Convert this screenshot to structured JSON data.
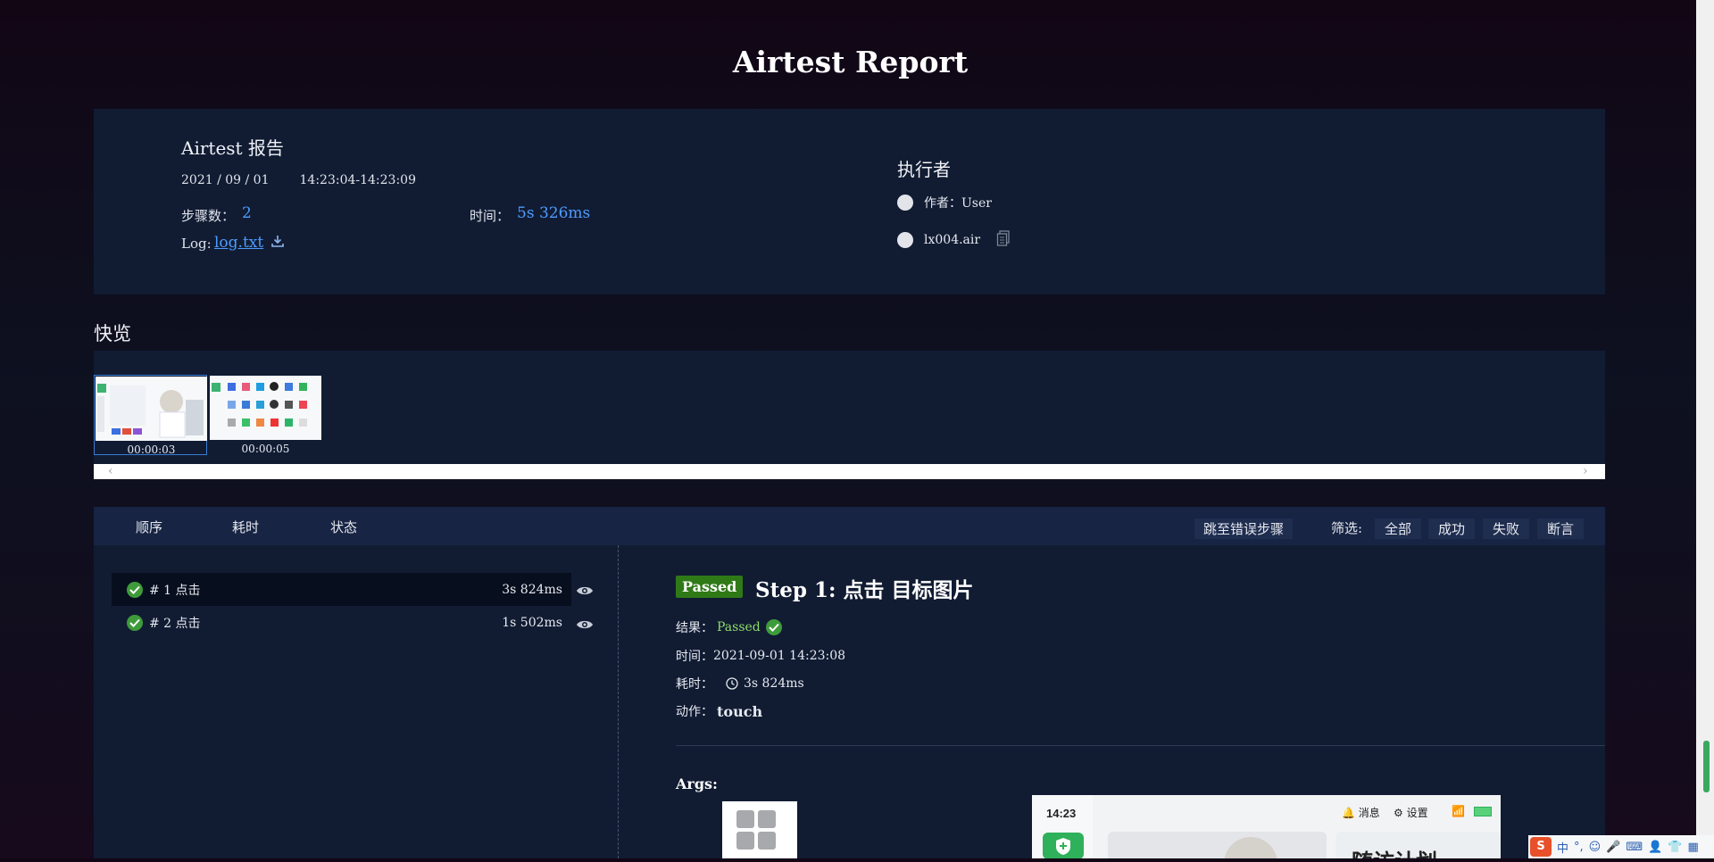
{
  "page_title": "Airtest Report",
  "info": {
    "report_name": "Airtest 报告",
    "date": "2021 / 09 / 01",
    "time_range": "14:23:04-14:23:09",
    "steps_label": "步骤数：",
    "steps_value": "2",
    "time_label": "时间：",
    "time_value": "5s 326ms",
    "log_label": "Log:",
    "log_link": "log.txt",
    "executor_title": "执行者",
    "author_label": "作者：",
    "author_value": "User",
    "script_name": "lx004.air"
  },
  "overview": {
    "title": "快览",
    "thumbnails": [
      {
        "caption": "00:00:03"
      },
      {
        "caption": "00:00:05"
      }
    ]
  },
  "list_header": {
    "sort_order": "顺序",
    "sort_duration": "耗时",
    "sort_status": "状态",
    "jump_error": "跳至错误步骤",
    "filter_label": "筛选:",
    "filter_all": "全部",
    "filter_success": "成功",
    "filter_fail": "失败",
    "filter_assert": "断言"
  },
  "steps": [
    {
      "label": "# 1 点击",
      "duration": "3s 824ms"
    },
    {
      "label": "# 2 点击",
      "duration": "1s 502ms"
    }
  ],
  "detail": {
    "badge": "Passed",
    "title": "Step 1: 点击 目标图片",
    "result_label": "结果：",
    "result_value": "Passed",
    "time_label": "时间：",
    "time_value": "2021-09-01 14:23:08",
    "duration_label": "耗时：",
    "duration_value": "3s 824ms",
    "action_label": "动作：",
    "action_value": "touch",
    "args_label": "Args:"
  },
  "screenshot_preview": {
    "time": "14:23",
    "messages": "消息",
    "settings": "设置",
    "banner": "随访计划"
  },
  "ime": {
    "lang": "中",
    "punct": "°,"
  },
  "colors": {
    "accent_link": "#4f9bff",
    "pass_badge": "#2f7a17",
    "panel": "#111c33",
    "header_bar": "#172443"
  }
}
